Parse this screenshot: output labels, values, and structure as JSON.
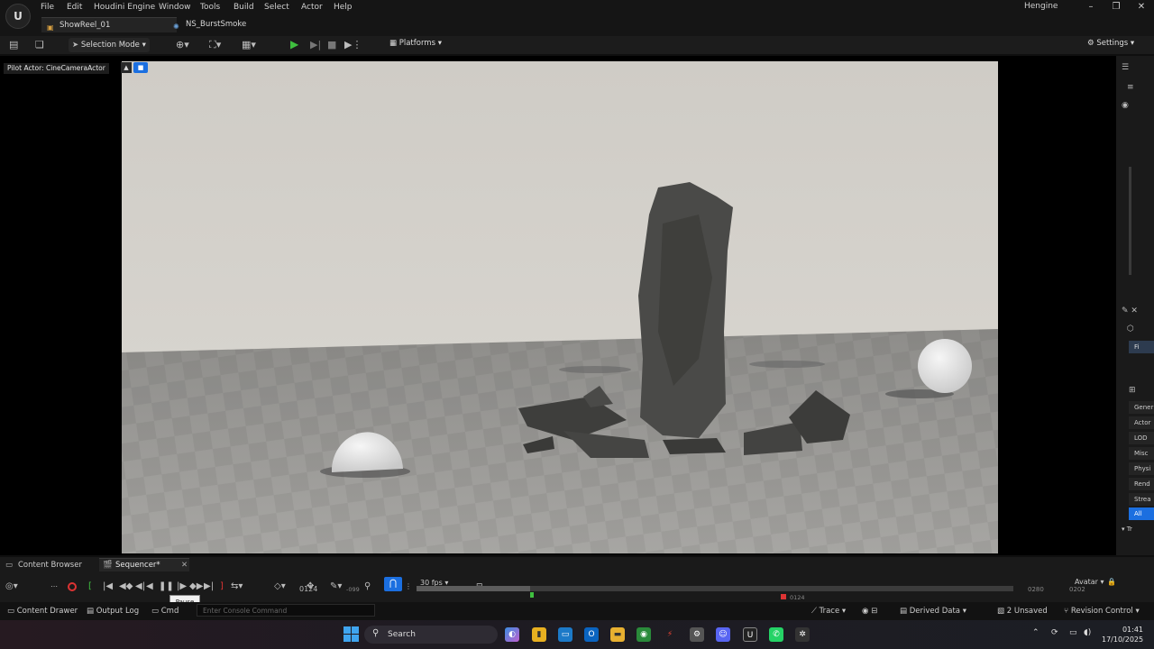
{
  "app": {
    "logo": "U",
    "menu": [
      "File",
      "Edit",
      "Houdini Engine",
      "Window",
      "Tools",
      "Build",
      "Select",
      "Actor",
      "Help"
    ],
    "tabs": [
      "ShowReel_01",
      "NS_BurstSmoke"
    ],
    "user": "Hengine"
  },
  "toolbar": {
    "selection_mode": "Selection Mode",
    "platforms": "Platforms",
    "settings": "Settings"
  },
  "viewport": {
    "pilot_label": "Pilot Actor: CineCameraActor"
  },
  "right_panel": {
    "labels": [
      "Gener",
      "Actor",
      "LOD",
      "Misc",
      "Physi",
      "Rend",
      "Strea",
      "All"
    ],
    "top_label": "Fi",
    "bottom_label": "Tr"
  },
  "sequencer": {
    "tabs": [
      "Content Browser",
      "Sequencer*"
    ],
    "fps": "30 fps",
    "frame_current": "0124",
    "frame_neg": "-099",
    "frame_end_a": "0280",
    "frame_end_b": "0202",
    "frame_marker": "0124",
    "avatar_label": "Avatar",
    "tooltip": "Pause",
    "timeline_progress": 0.19
  },
  "status": {
    "content_drawer": "Content Drawer",
    "output_log": "Output Log",
    "cmd": "Cmd",
    "console_placeholder": "Enter Console Command",
    "trace": "Trace",
    "derived_data": "Derived Data",
    "unsaved": "2 Unsaved",
    "revision_control": "Revision Control"
  },
  "taskbar": {
    "search": "Search",
    "time": "01:41",
    "date": "17/10/2025"
  },
  "colors": {
    "accent": "#1b6fe0",
    "play": "#3fbf3f",
    "record": "#dd3333"
  }
}
